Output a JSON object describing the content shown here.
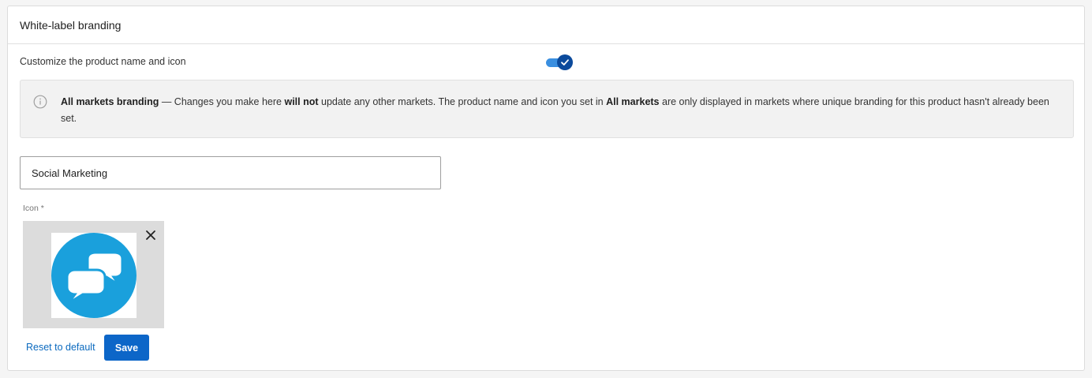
{
  "card": {
    "title": "White-label branding"
  },
  "customize": {
    "label": "Customize the product name and icon",
    "enabled": true
  },
  "alert": {
    "icon": "info-circle-icon",
    "title": "All markets branding",
    "dash": " — ",
    "text1": "Changes you make here ",
    "bold1": "will not",
    "text2": " update any other markets. The product name and icon you set in ",
    "bold2": "All markets",
    "text3": " are only displayed in markets where unique branding for this product hasn't already been set."
  },
  "product_name": {
    "value": "Social Marketing"
  },
  "icon_field": {
    "label": "Icon *",
    "image": "speech-bubbles-icon",
    "image_color": "#1aa0dc",
    "remove_icon": "close-icon"
  },
  "actions": {
    "reset_label": "Reset to default",
    "save_label": "Save"
  },
  "colors": {
    "primary": "#0c66c8",
    "link": "#0b6abf",
    "toggle_track": "#3a8fe0",
    "toggle_knob": "#0b4a9c"
  }
}
